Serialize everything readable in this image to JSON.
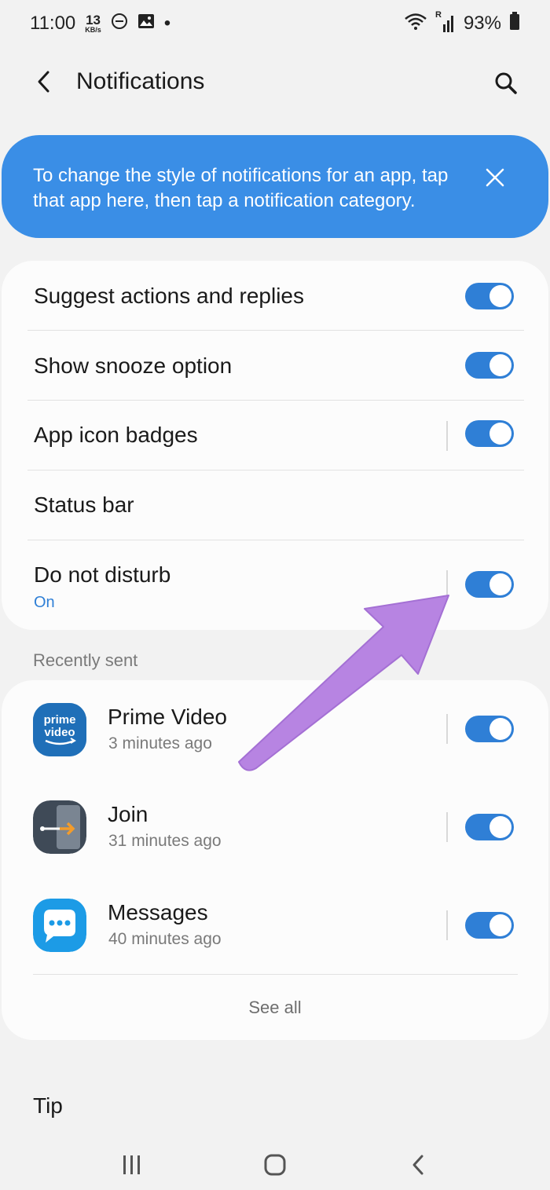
{
  "status_bar": {
    "time": "11:00",
    "net_speed_value": "13",
    "net_speed_unit": "KB/s",
    "dot": "•",
    "signal_label": "R",
    "battery": "93%"
  },
  "app_bar": {
    "title": "Notifications",
    "back_icon": "back-arrow-icon",
    "search_icon": "search-icon"
  },
  "banner": {
    "text": "To change the style of notifications for an app, tap that app here, then tap a notification category.",
    "close_icon": "close-icon",
    "color": "#3a8ee6"
  },
  "settings": {
    "items": [
      {
        "label": "Suggest actions and replies",
        "toggle": true
      },
      {
        "label": "Show snooze option",
        "toggle": true
      },
      {
        "label": "App icon badges",
        "toggle": true
      },
      {
        "label": "Status bar"
      },
      {
        "label": "Do not disturb",
        "sublabel": "On",
        "toggle": true
      }
    ]
  },
  "recent": {
    "header": "Recently sent",
    "apps": [
      {
        "name": "Prime Video",
        "time": "3 minutes ago",
        "icon": "prime-video-icon",
        "icon_text_1": "prime",
        "icon_text_2": "video",
        "toggle": true
      },
      {
        "name": "Join",
        "time": "31 minutes ago",
        "icon": "join-icon",
        "toggle": true
      },
      {
        "name": "Messages",
        "time": "40 minutes ago",
        "icon": "messages-icon",
        "toggle": true
      }
    ],
    "see_all": "See all"
  },
  "tip": {
    "label": "Tip"
  },
  "nav": {
    "recents_icon": "recents-icon",
    "home_icon": "home-icon",
    "back_icon": "nav-back-icon"
  },
  "colors": {
    "accent": "#2f7fd6",
    "annotation_arrow": "#b784e2",
    "background": "#f2f2f2"
  }
}
